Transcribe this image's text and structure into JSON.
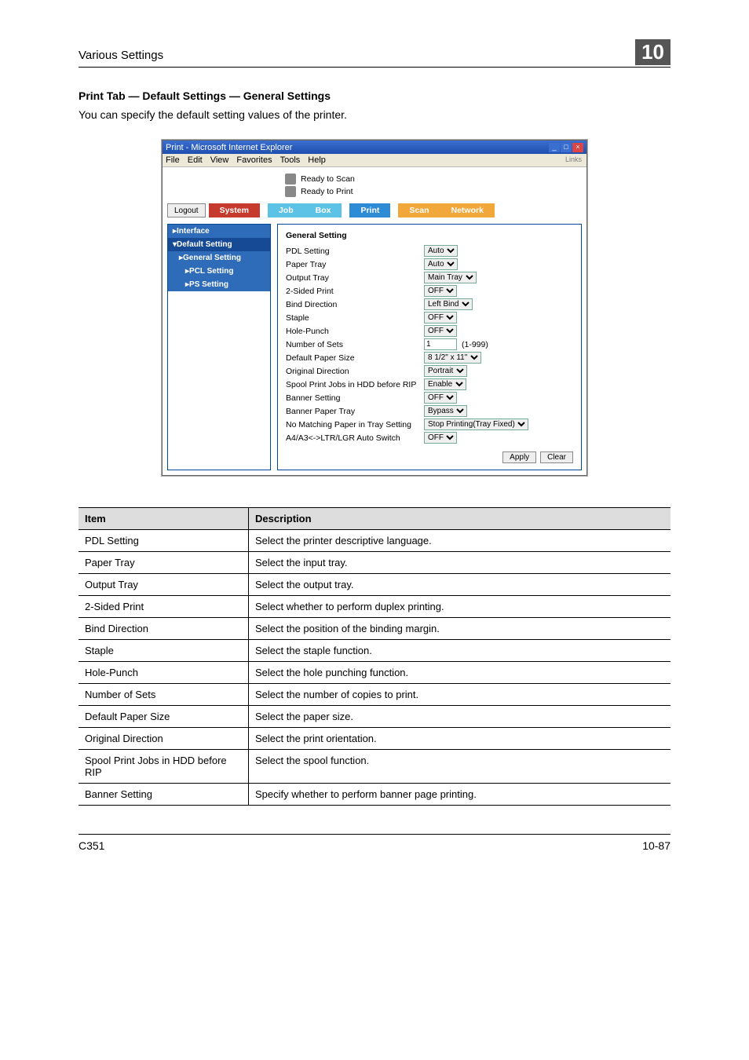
{
  "header": {
    "section": "Various Settings",
    "chapter_num": "10"
  },
  "section": {
    "title": "Print Tab — Default Settings — General Settings",
    "intro": "You can specify the default setting values of the printer."
  },
  "ie": {
    "title": "Print - Microsoft Internet Explorer",
    "menu": {
      "file": "File",
      "edit": "Edit",
      "view": "View",
      "favorites": "Favorites",
      "tools": "Tools",
      "help": "Help"
    },
    "links": "Links"
  },
  "status": {
    "scan": "Ready to Scan",
    "print": "Ready to Print"
  },
  "tabs": {
    "logout": "Logout",
    "system": "System",
    "job": "Job",
    "box": "Box",
    "print": "Print",
    "scan": "Scan",
    "network": "Network"
  },
  "sidebar": {
    "interface": "▸Interface",
    "default": "▾Default Setting",
    "general": "▸General Setting",
    "pcl": "▸PCL Setting",
    "ps": "▸PS Setting"
  },
  "form": {
    "heading": "General Setting",
    "rows": {
      "pdl": {
        "label": "PDL Setting",
        "value": "Auto"
      },
      "paper": {
        "label": "Paper Tray",
        "value": "Auto"
      },
      "output": {
        "label": "Output Tray",
        "value": "Main Tray"
      },
      "duplex": {
        "label": "2-Sided Print",
        "value": "OFF"
      },
      "bind": {
        "label": "Bind Direction",
        "value": "Left Bind"
      },
      "staple": {
        "label": "Staple",
        "value": "OFF"
      },
      "hole": {
        "label": "Hole-Punch",
        "value": "OFF"
      },
      "sets": {
        "label": "Number of Sets",
        "value": "1",
        "hint": "(1-999)"
      },
      "size": {
        "label": "Default Paper Size",
        "value": "8 1/2\" x 11\""
      },
      "orient": {
        "label": "Original Direction",
        "value": "Portrait"
      },
      "spool": {
        "label": "Spool Print Jobs in HDD before RIP",
        "value": "Enable"
      },
      "banner": {
        "label": "Banner Setting",
        "value": "OFF"
      },
      "bannertray": {
        "label": "Banner Paper Tray",
        "value": "Bypass"
      },
      "nomatch": {
        "label": "No Matching Paper in Tray Setting",
        "value": "Stop Printing(Tray Fixed)"
      },
      "autoswitch": {
        "label": "A4/A3<->LTR/LGR Auto Switch",
        "value": "OFF"
      }
    },
    "buttons": {
      "apply": "Apply",
      "clear": "Clear"
    }
  },
  "table": {
    "head": {
      "item": "Item",
      "desc": "Description"
    },
    "rows": [
      {
        "item": "PDL Setting",
        "desc": "Select the printer descriptive language."
      },
      {
        "item": "Paper Tray",
        "desc": "Select the input tray."
      },
      {
        "item": "Output Tray",
        "desc": "Select the output tray."
      },
      {
        "item": "2-Sided Print",
        "desc": "Select whether to perform duplex printing."
      },
      {
        "item": "Bind Direction",
        "desc": "Select the position of the binding margin."
      },
      {
        "item": "Staple",
        "desc": "Select the staple function."
      },
      {
        "item": "Hole-Punch",
        "desc": "Select the hole punching function."
      },
      {
        "item": "Number of Sets",
        "desc": "Select the number of copies to print."
      },
      {
        "item": "Default Paper Size",
        "desc": "Select the paper size."
      },
      {
        "item": "Original Direction",
        "desc": "Select the print orientation."
      },
      {
        "item": "Spool Print Jobs in HDD before RIP",
        "desc": "Select the spool function."
      },
      {
        "item": "Banner Setting",
        "desc": "Specify whether to perform banner page printing."
      }
    ]
  },
  "footer": {
    "left": "C351",
    "right": "10-87"
  }
}
